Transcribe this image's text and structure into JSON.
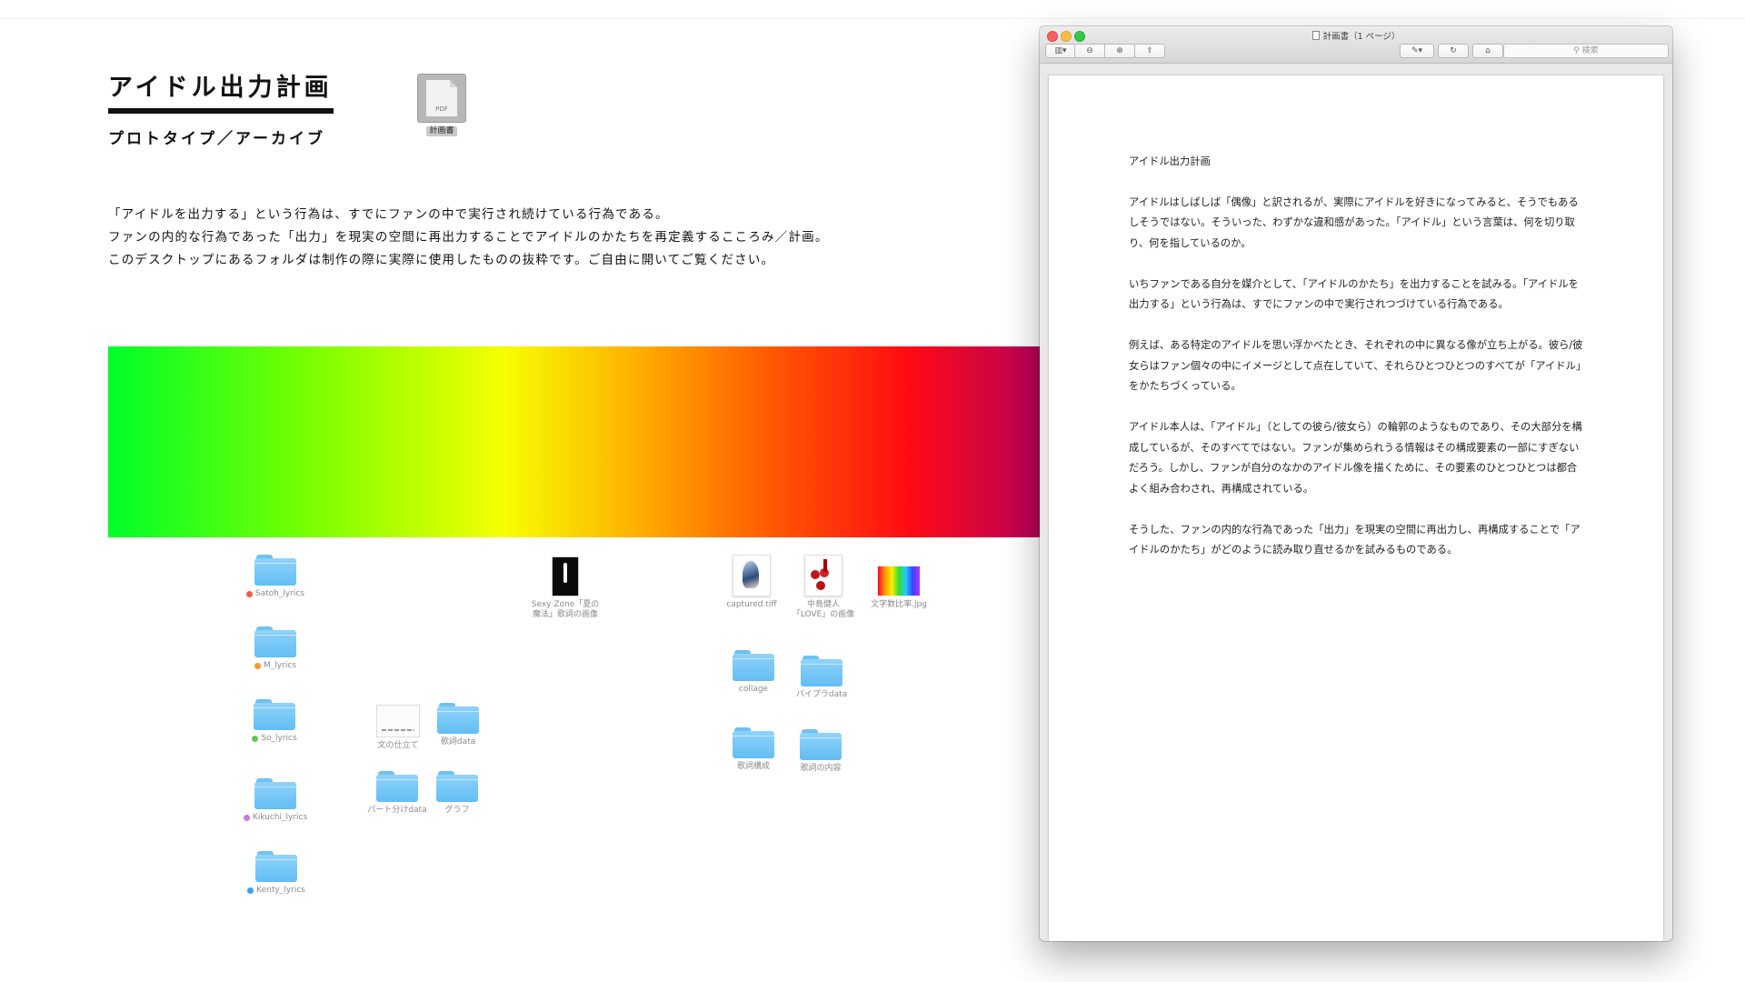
{
  "desktop": {
    "title": "アイドル出力計画",
    "subtitle": "プロトタイプ／アーカイブ",
    "intro": [
      "「アイドルを出力する」という行為は、すでにファンの中で実行され続けている行為である。",
      "ファンの内的な行為であった「出力」を現実の空間に再出力することでアイドルのかたちを再定義するこころみ／計画。",
      "このデスクトップにあるフォルダは制作の際に実際に使用したものの抜粋です。ご自由に開いてご覧ください。"
    ],
    "pdf_icon": {
      "label": "計画書",
      "badge": "PDF"
    },
    "folders": [
      {
        "label": "Satoh_lyrics",
        "tag_color": "#f05a4f"
      },
      {
        "label": "M_lyrics",
        "tag_color": "#f29b2f"
      },
      {
        "label": "So_lyrics",
        "tag_color": "#5fc94f"
      },
      {
        "label": "Kikuchi_lyrics",
        "tag_color": "#c57be3"
      },
      {
        "label": "Kenty_lyrics",
        "tag_color": "#3aa0f0"
      },
      {
        "label": "文の仕立て",
        "tag_color": ""
      },
      {
        "label": "歌詞data",
        "tag_color": ""
      },
      {
        "label": "パート分けdata",
        "tag_color": ""
      },
      {
        "label": "グラフ",
        "tag_color": ""
      },
      {
        "label": "collage",
        "tag_color": ""
      },
      {
        "label": "パイプラdata",
        "tag_color": ""
      },
      {
        "label": "歌詞構成",
        "tag_color": ""
      },
      {
        "label": "歌詞の内容",
        "tag_color": ""
      }
    ],
    "files": [
      {
        "label": "Sexy Zone「夏の\n魔法」歌詞の画像",
        "icon": "photo-icon"
      },
      {
        "label": "captured.tiff",
        "icon": "photo-icon"
      },
      {
        "label": "中島健人\n「LOVE」の画像",
        "icon": "photo-icon"
      },
      {
        "label": "文字数比率.jpg",
        "icon": "rainbow-image-icon"
      }
    ]
  },
  "preview": {
    "window_title": "計画書（1 ページ）",
    "search_placeholder": "検索",
    "toolbar_icons": [
      "sidebar-icon",
      "zoom-out-icon",
      "zoom-in-icon",
      "share-icon",
      "markup-icon",
      "rotate-icon",
      "toolbox-icon"
    ],
    "document": {
      "title": "アイドル出力計画",
      "paragraphs": [
        "アイドルはしばしば「偶像」と訳されるが、実際にアイドルを好きになってみると、そうでもあるしそうではない。そういった、わずかな違和感があった。「アイドル」という言葉は、何を切り取り、何を指しているのか。",
        "いちファンである自分を媒介として、「アイドルのかたち」を出力することを試みる。「アイドルを出力する」という行為は、すでにファンの中で実行されつづけている行為である。",
        "例えば、ある特定のアイドルを思い浮かべたとき、それぞれの中に異なる像が立ち上がる。彼ら/彼女らはファン個々の中にイメージとして点在していて、それらひとつひとつのすべてが「アイドル」をかたちづくっている。",
        "アイドル本人は、「アイドル」（としての彼ら/彼女ら）の輪郭のようなものであり、その大部分を構成しているが、そのすべてではない。ファンが集められうる情報はその構成要素の一部にすぎないだろう。しかし、ファンが自分のなかのアイドル像を描くために、その要素のひとつひとつは都合よく組み合わされ、再構成されている。",
        "そうした、ファンの内的な行為であった「出力」を現実の空間に再出力し、再構成することで「アイドルのかたち」がどのように読み取り直せるかを試みるものである。"
      ]
    }
  },
  "gradient": {
    "stops": [
      "#00ff2a",
      "#7dff00",
      "#f6ff00",
      "#ffb000",
      "#ff5b00",
      "#ff0a14",
      "#b20060"
    ]
  }
}
